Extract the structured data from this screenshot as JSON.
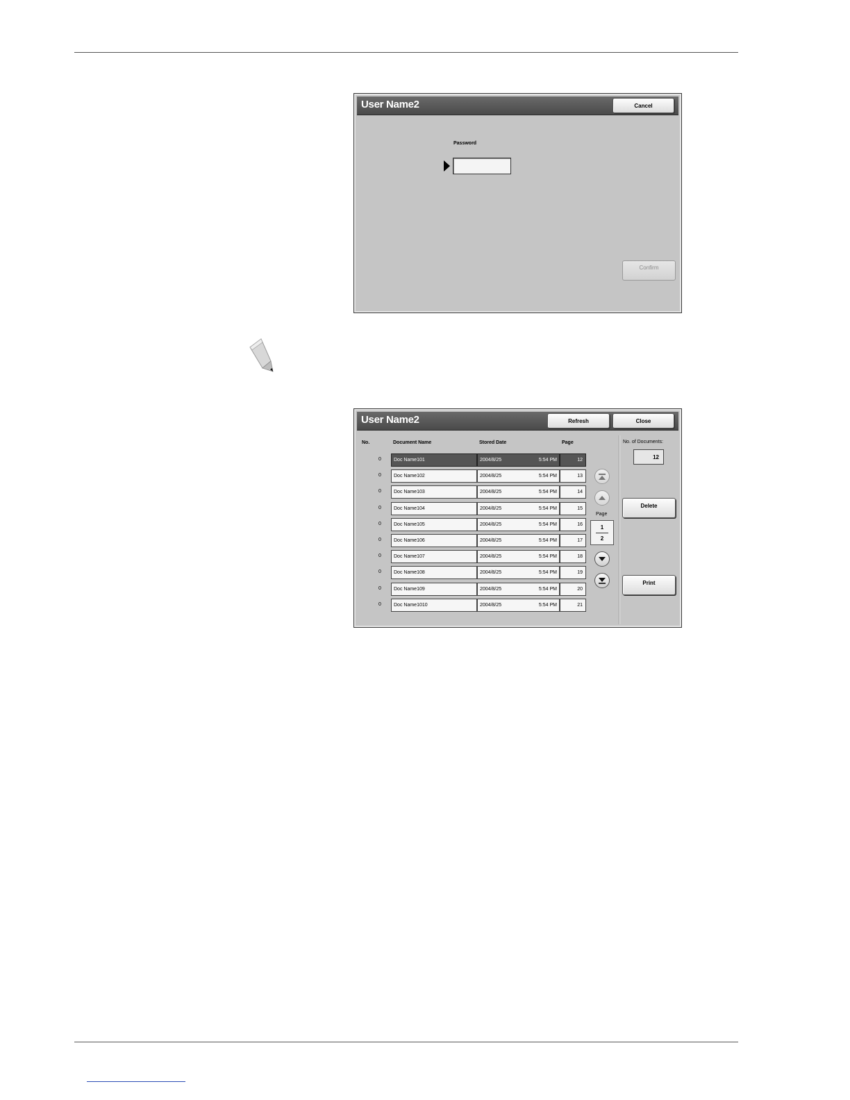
{
  "password_dialog": {
    "title": "User Name2",
    "cancel_label": "Cancel",
    "password_label": "Password",
    "password_value": "",
    "confirm_label": "Confirm"
  },
  "document_dialog": {
    "title": "User Name2",
    "refresh_label": "Refresh",
    "close_label": "Close",
    "columns": {
      "no": "No.",
      "name": "Document Name",
      "date": "Stored Date",
      "page": "Page"
    },
    "rows": [
      {
        "no": "0",
        "name": "Doc Name101",
        "date": "2004/8/25",
        "time": "5:54 PM",
        "page": "12"
      },
      {
        "no": "0",
        "name": "Doc Name102",
        "date": "2004/8/25",
        "time": "5:54 PM",
        "page": "13"
      },
      {
        "no": "0",
        "name": "Doc Name103",
        "date": "2004/8/25",
        "time": "5:54 PM",
        "page": "14"
      },
      {
        "no": "0",
        "name": "Doc Name104",
        "date": "2004/8/25",
        "time": "5:54 PM",
        "page": "15"
      },
      {
        "no": "0",
        "name": "Doc Name105",
        "date": "2004/8/25",
        "time": "5:54 PM",
        "page": "16"
      },
      {
        "no": "0",
        "name": "Doc Name106",
        "date": "2004/8/25",
        "time": "5:54 PM",
        "page": "17"
      },
      {
        "no": "0",
        "name": "Doc Name107",
        "date": "2004/8/25",
        "time": "5:54 PM",
        "page": "18"
      },
      {
        "no": "0",
        "name": "Doc Name108",
        "date": "2004/8/25",
        "time": "5:54 PM",
        "page": "19"
      },
      {
        "no": "0",
        "name": "Doc Name109",
        "date": "2004/8/25",
        "time": "5:54 PM",
        "page": "20"
      },
      {
        "no": "0",
        "name": "Doc Name1010",
        "date": "2004/8/25",
        "time": "5:54 PM",
        "page": "21"
      }
    ],
    "selected_row": 0,
    "page_label": "Page",
    "current_page": "1",
    "total_pages": "2",
    "count_label": "No. of Documents:",
    "count_value": "12",
    "delete_label": "Delete",
    "print_label": "Print"
  },
  "icons": {
    "note": "pencil-icon",
    "nav_first": "page-top-icon",
    "nav_prev": "page-up-icon",
    "nav_next": "page-down-icon",
    "nav_last": "page-bottom-icon",
    "field_pointer": "pointer-arrow-icon"
  }
}
